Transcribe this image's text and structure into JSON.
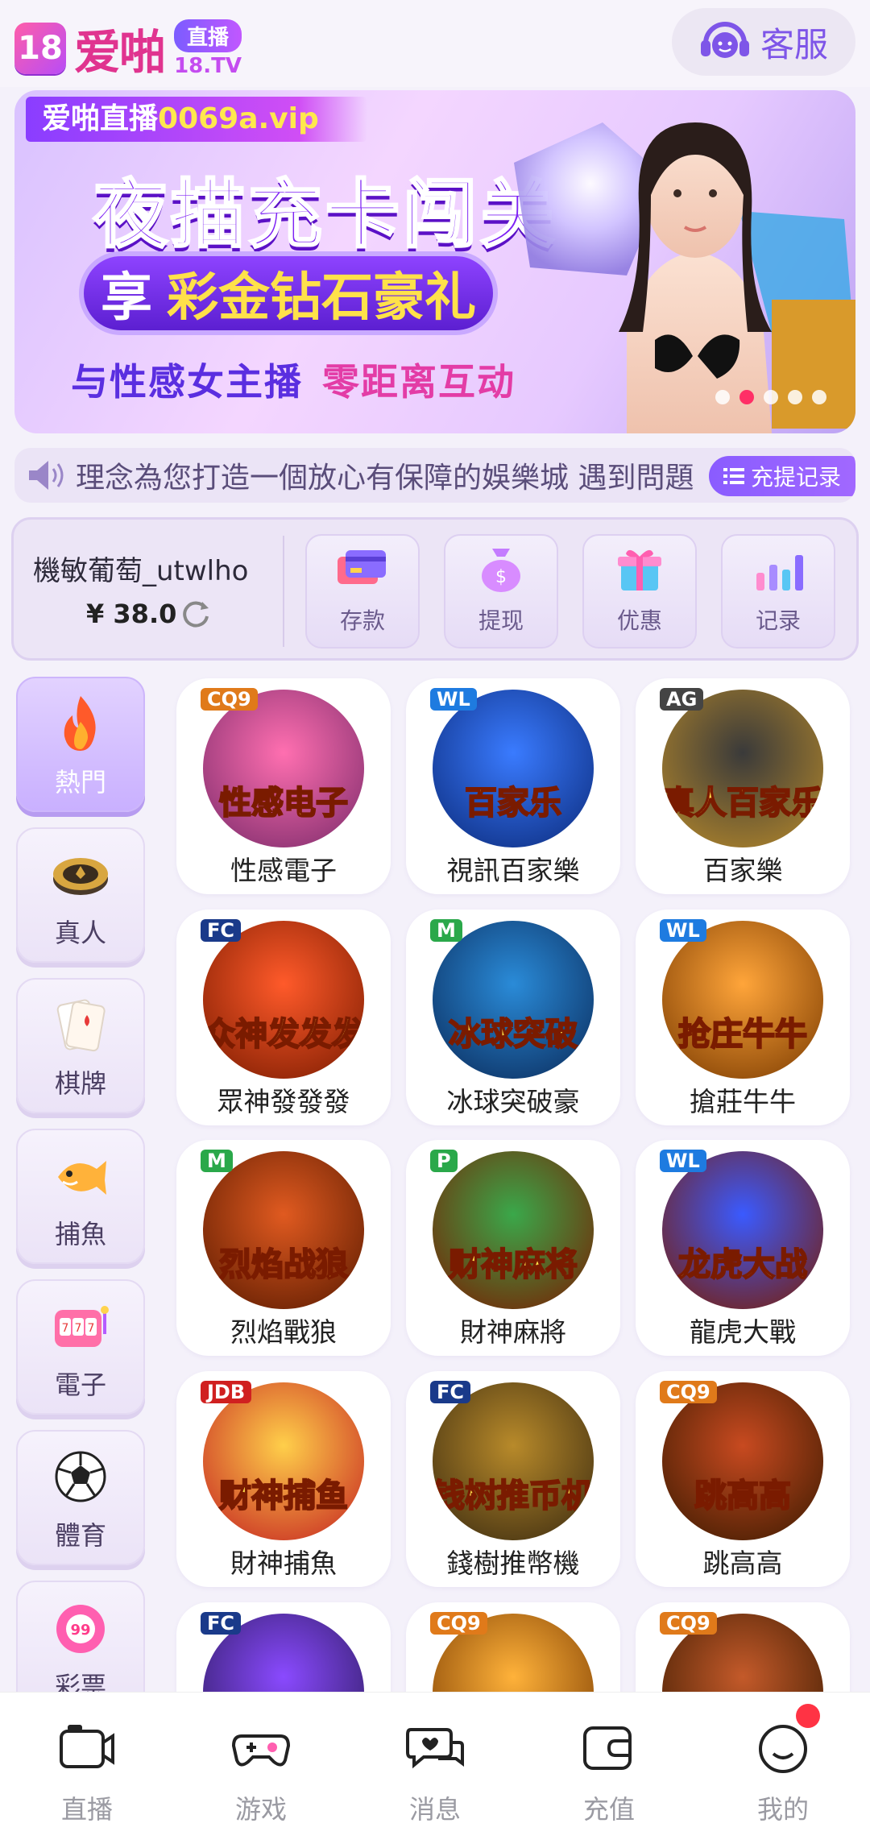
{
  "header": {
    "logo_mark": "18",
    "logo_text": "爱啪",
    "logo_live": "直播",
    "logo_tv": "18.TV",
    "support_label": "客服"
  },
  "banner": {
    "tag_prefix": "爱啪直播",
    "tag_url": "0069a.vip",
    "title": "夜描充卡闯关",
    "pill_prefix": "享",
    "pill_highlight": "彩金钻石豪礼",
    "line_a": "与性感女主播",
    "line_b": "零距离互动",
    "slides": 5,
    "active_slide": 2
  },
  "marquee": {
    "text": "理念為您打造一個放心有保障的娛樂城  遇到問題",
    "records_label": "充提记录"
  },
  "account": {
    "username": "機敏葡萄_utwlho",
    "balance": "¥ 38.0",
    "actions": [
      {
        "label": "存款",
        "icon": "card-icon"
      },
      {
        "label": "提现",
        "icon": "money-bag-icon"
      },
      {
        "label": "优惠",
        "icon": "gift-icon"
      },
      {
        "label": "记录",
        "icon": "bar-chart-icon"
      }
    ]
  },
  "sidebar": {
    "items": [
      {
        "label": "熱門",
        "icon": "flame-icon",
        "active": true
      },
      {
        "label": "真人",
        "icon": "poker-chip-icon"
      },
      {
        "label": "棋牌",
        "icon": "cards-icon"
      },
      {
        "label": "捕魚",
        "icon": "fish-icon"
      },
      {
        "label": "電子",
        "icon": "slot-icon"
      },
      {
        "label": "體育",
        "icon": "soccer-ball-icon"
      },
      {
        "label": "彩票",
        "icon": "lottery-ball-icon"
      }
    ]
  },
  "games": [
    {
      "name": "性感電子",
      "provider": "CQ9",
      "art": "性感电子"
    },
    {
      "name": "視訊百家樂",
      "provider": "WL",
      "art": "百家乐"
    },
    {
      "name": "百家樂",
      "provider": "AG",
      "art": "真人百家乐"
    },
    {
      "name": "眾神發發發",
      "provider": "FC",
      "art": "众神发发发"
    },
    {
      "name": "冰球突破豪",
      "provider": "M",
      "art": "冰球突破"
    },
    {
      "name": "搶莊牛牛",
      "provider": "WL",
      "art": "抢庄牛牛"
    },
    {
      "name": "烈焰戰狼",
      "provider": "M",
      "art": "烈焰战狼"
    },
    {
      "name": "財神麻將",
      "provider": "P",
      "art": "财神麻将"
    },
    {
      "name": "龍虎大戰",
      "provider": "WL",
      "art": "龙虎大战"
    },
    {
      "name": "財神捕魚",
      "provider": "JDB",
      "art": "财神捕鱼"
    },
    {
      "name": "錢樹推幣機",
      "provider": "FC",
      "art": "钱树推币机"
    },
    {
      "name": "跳高高",
      "provider": "CQ9",
      "art": "跳高高"
    },
    {
      "name": "",
      "provider": "FC",
      "art": ""
    },
    {
      "name": "",
      "provider": "CQ9",
      "art": ""
    },
    {
      "name": "",
      "provider": "CQ9",
      "art": ""
    }
  ],
  "bottom_nav": [
    {
      "label": "直播",
      "icon": "camera-icon"
    },
    {
      "label": "游戏",
      "icon": "gamepad-icon"
    },
    {
      "label": "消息",
      "icon": "chat-icon"
    },
    {
      "label": "充值",
      "icon": "wallet-icon"
    },
    {
      "label": "我的",
      "icon": "profile-icon",
      "badge": true
    }
  ],
  "colors": {
    "accent": "#8a5cff",
    "brand_pink": "#e0348f",
    "background": "#f4f1fa"
  }
}
